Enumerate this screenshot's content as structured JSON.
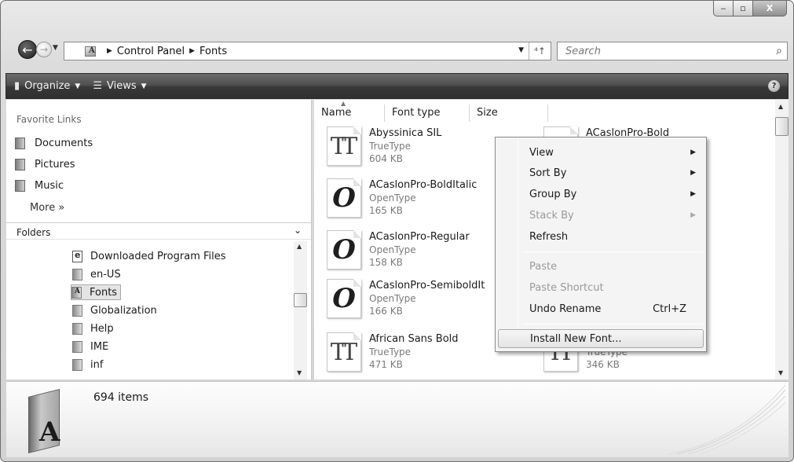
{
  "window": {
    "caption": {
      "minimize": "‒",
      "maximize": "▫",
      "close": "X"
    }
  },
  "nav": {
    "back_glyph": "←",
    "forward_glyph": "→"
  },
  "address": {
    "crumbs": [
      "Control Panel",
      "Fonts"
    ],
    "refresh_glyph": "⁴↑"
  },
  "search": {
    "placeholder": "Search"
  },
  "toolbar": {
    "organize_label": "Organize",
    "views_label": "Views",
    "help_label": "?"
  },
  "navpane": {
    "favorites_header": "Favorite Links",
    "favorites": [
      {
        "label": "Documents",
        "icon": "documents-icon"
      },
      {
        "label": "Pictures",
        "icon": "pictures-icon"
      },
      {
        "label": "Music",
        "icon": "music-icon"
      }
    ],
    "more_label": "More  »",
    "folders_label": "Folders",
    "tree": [
      {
        "label": "Downloaded Program Files",
        "icon": "ie-folder-icon"
      },
      {
        "label": "en-US",
        "icon": "folder-icon"
      },
      {
        "label": "Fonts",
        "icon": "fonts-folder-icon",
        "selected": true
      },
      {
        "label": "Globalization",
        "icon": "folder-icon"
      },
      {
        "label": "Help",
        "icon": "folder-icon"
      },
      {
        "label": "IME",
        "icon": "folder-icon"
      },
      {
        "label": "inf",
        "icon": "folder-icon"
      }
    ]
  },
  "filelist": {
    "columns": [
      "Name",
      "Font type",
      "Size"
    ],
    "items": [
      {
        "name": "Abyssinica SIL",
        "type": "TrueType",
        "size": "604 KB",
        "glyph": "TT"
      },
      {
        "name": "ACaslonPro-BoldItalic",
        "type": "OpenType",
        "size": "165 KB",
        "glyph": "O"
      },
      {
        "name": "ACaslonPro-Regular",
        "type": "OpenType",
        "size": "158 KB",
        "glyph": "O"
      },
      {
        "name": "ACaslonPro-SemiboldIt",
        "type": "OpenType",
        "size": "166 KB",
        "glyph": "O"
      },
      {
        "name": "African Sans Bold",
        "type": "TrueType",
        "size": "471 KB",
        "glyph": "TT"
      }
    ],
    "right_items": [
      {
        "name": "ACaslonPro-Bold"
      },
      {
        "type": "TrueType",
        "size": "346 KB",
        "glyph": "TT"
      }
    ]
  },
  "context_menu": {
    "items": [
      {
        "label": "View",
        "submenu": true,
        "disabled": false
      },
      {
        "label": "Sort By",
        "submenu": true,
        "disabled": false
      },
      {
        "label": "Group By",
        "submenu": true,
        "disabled": false
      },
      {
        "label": "Stack By",
        "submenu": true,
        "disabled": true
      },
      {
        "label": "Refresh",
        "submenu": false,
        "disabled": false
      },
      {
        "label": "Paste",
        "submenu": false,
        "disabled": true
      },
      {
        "label": "Paste Shortcut",
        "submenu": false,
        "disabled": true
      },
      {
        "label": "Undo Rename",
        "submenu": false,
        "disabled": false,
        "shortcut": "Ctrl+Z"
      },
      {
        "label": "Install New Font...",
        "submenu": false,
        "disabled": false,
        "hover": true
      }
    ]
  },
  "details": {
    "count": "694 items",
    "icon_letter": "A"
  }
}
